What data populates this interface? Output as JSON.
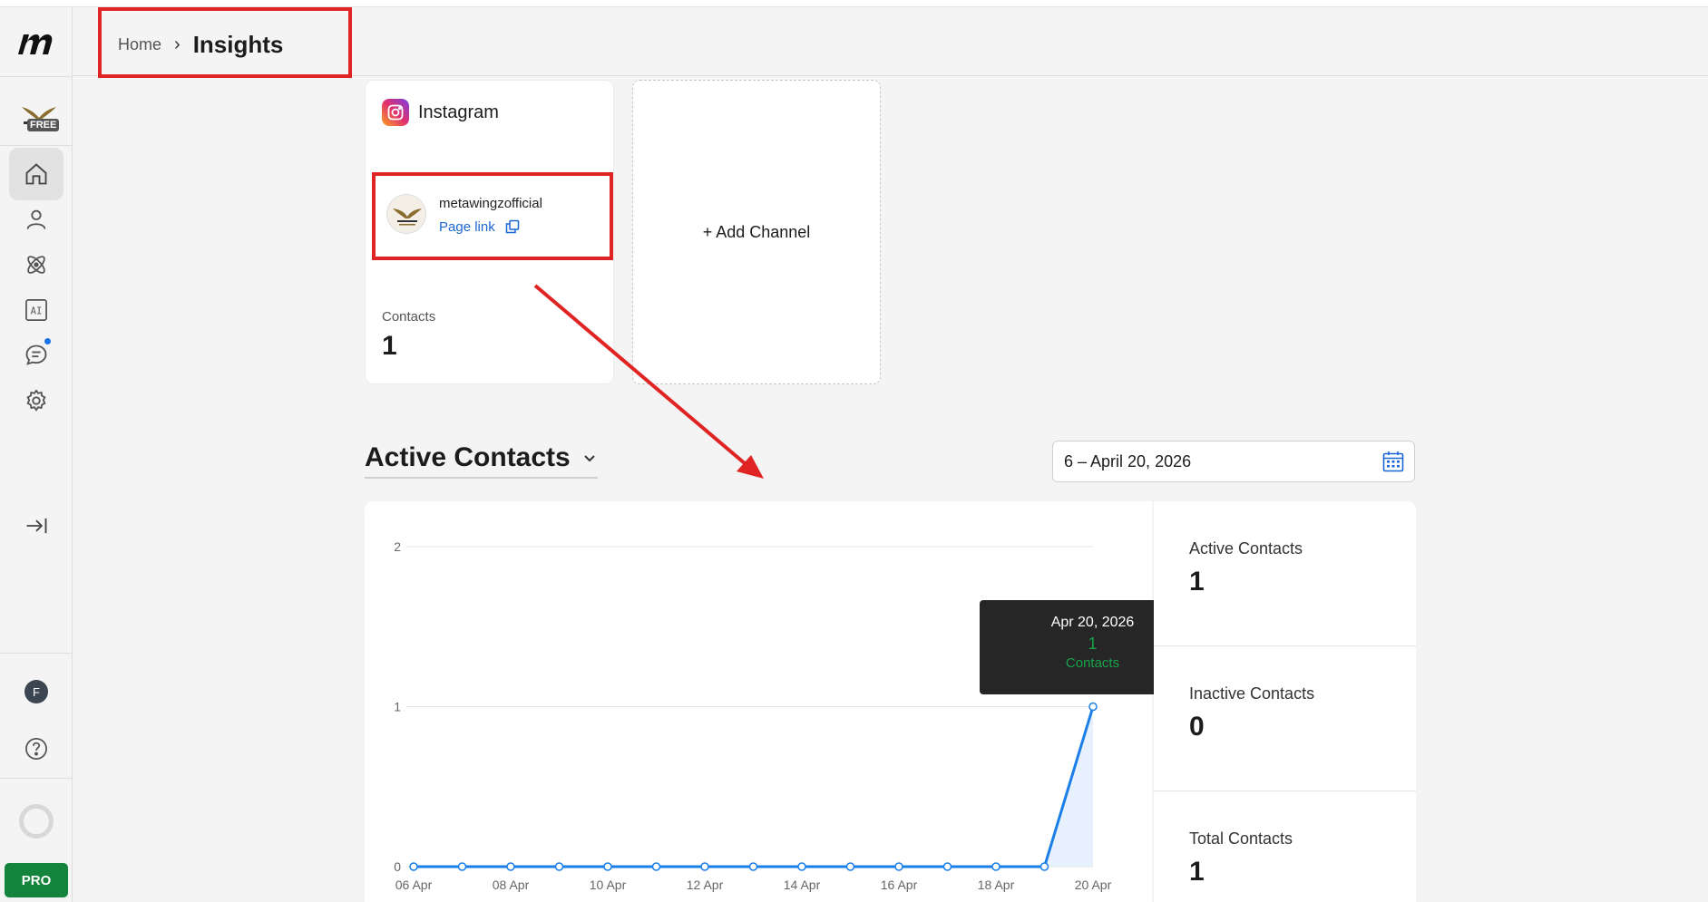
{
  "breadcrumb": {
    "home": "Home",
    "separator": "›",
    "current": "Insights"
  },
  "sidebar": {
    "workspace_badge": "FREE",
    "nav_items": [
      {
        "icon": "home-icon",
        "active": true
      },
      {
        "icon": "user-icon"
      },
      {
        "icon": "atom-icon"
      },
      {
        "icon": "ai-icon",
        "text": "AI"
      },
      {
        "icon": "chat-icon",
        "notification": true
      },
      {
        "icon": "gear-icon"
      }
    ],
    "user_initial": "F",
    "pro_label": "PRO"
  },
  "channel_card": {
    "platform": "Instagram",
    "account_name": "metawingzofficial",
    "page_link_label": "Page link",
    "contacts_label": "Contacts",
    "contacts_value": "1"
  },
  "add_channel": {
    "label": "+ Add Channel"
  },
  "section": {
    "title": "Active Contacts"
  },
  "date_range": {
    "text": "6 – April 20, 2026"
  },
  "tooltip": {
    "date": "Apr 20, 2026",
    "value": "1",
    "label": "Contacts"
  },
  "stats": [
    {
      "label": "Active Contacts",
      "value": "1"
    },
    {
      "label": "Inactive Contacts",
      "value": "0"
    },
    {
      "label": "Total Contacts",
      "value": "1"
    }
  ],
  "colors": {
    "accent": "#1a7ee8",
    "pro_green": "#14833b",
    "highlight_red": "#e02424"
  },
  "chart_data": {
    "type": "line",
    "x": [
      "06 Apr",
      "07 Apr",
      "08 Apr",
      "09 Apr",
      "10 Apr",
      "11 Apr",
      "12 Apr",
      "13 Apr",
      "14 Apr",
      "15 Apr",
      "16 Apr",
      "17 Apr",
      "18 Apr",
      "19 Apr",
      "20 Apr"
    ],
    "x_tick_labels": [
      "06 Apr",
      "08 Apr",
      "10 Apr",
      "12 Apr",
      "14 Apr",
      "16 Apr",
      "18 Apr",
      "20 Apr"
    ],
    "series": [
      {
        "values": [
          0,
          0,
          0,
          0,
          0,
          0,
          0,
          0,
          0,
          0,
          0,
          0,
          0,
          0,
          1
        ]
      }
    ],
    "y_ticks": [
      0,
      1,
      2
    ],
    "ylim": [
      0,
      2
    ],
    "grid": true
  }
}
